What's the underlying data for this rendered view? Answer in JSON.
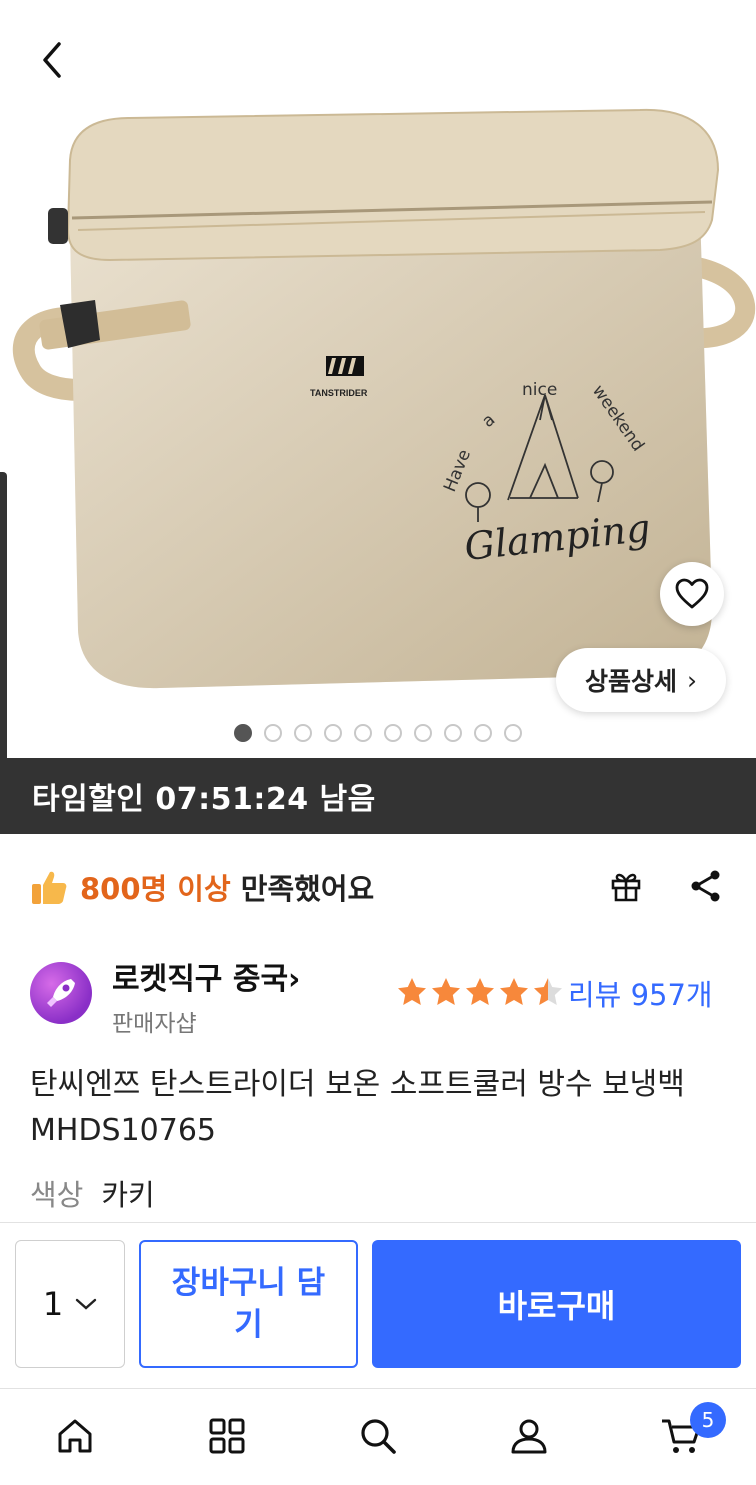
{
  "product_image": {
    "brand_text": "TANSTRIDER",
    "print_line1_words": [
      "Have",
      "a",
      "nice",
      "weekend"
    ],
    "print_script": "Glamping",
    "total_images": 10,
    "active_image_index": 0
  },
  "detail_button": {
    "label": "상품상세",
    "chevron": "›"
  },
  "timer": {
    "text": "타임할인 07:51:24 남음"
  },
  "satisfaction": {
    "highlight": "800명 이상",
    "rest": "만족했어요"
  },
  "seller": {
    "name": "로켓직구 중국",
    "chevron": "›",
    "sub": "판매자샵",
    "rating": 4.5,
    "review_text": "리뷰 957개"
  },
  "product": {
    "title": "탄씨엔쯔 탄스트라이더 보온 소프트쿨러 방수 보냉백 MHDS10765",
    "option_label": "색상",
    "option_value": "카키"
  },
  "buy_bar": {
    "quantity": "1",
    "cart_label": "장바구니 담기",
    "buy_label": "바로구매"
  },
  "nav": {
    "cart_badge": "5"
  },
  "colors": {
    "accent": "#346aff",
    "orange": "#e2651b",
    "banner": "#333333",
    "star": "#f7883b",
    "product_beige": "#ded0b5"
  }
}
